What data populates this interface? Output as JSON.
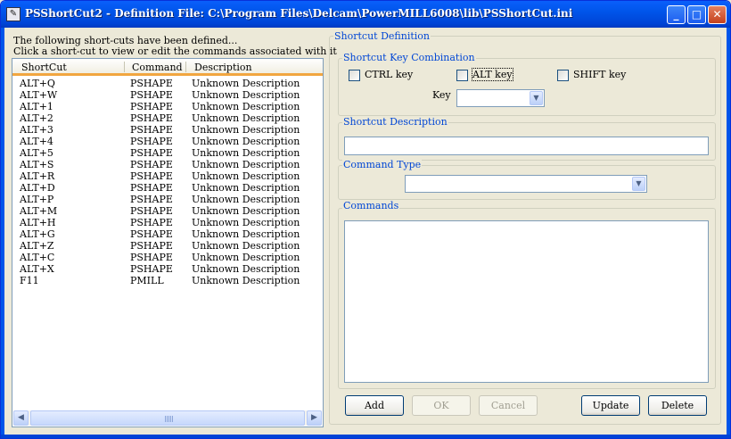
{
  "window": {
    "title": "PSShortCut2 - Definition File: C:\\Program Files\\Delcam\\PowerMILL6008\\lib\\PSShortCut.ini",
    "app_icon_glyph": "✎",
    "minimize_glyph": "_",
    "maximize_glyph": "□",
    "close_glyph": "✕"
  },
  "intro": {
    "line1": "The following short-cuts have been defined...",
    "line2": "Click a short-cut to view or edit the commands associated with it"
  },
  "list": {
    "columns": [
      "ShortCut",
      "Command",
      "Description"
    ],
    "rows": [
      [
        "ALT+Q",
        "PSHAPE",
        "Unknown Description"
      ],
      [
        "ALT+W",
        "PSHAPE",
        "Unknown Description"
      ],
      [
        "ALT+1",
        "PSHAPE",
        "Unknown Description"
      ],
      [
        "ALT+2",
        "PSHAPE",
        "Unknown Description"
      ],
      [
        "ALT+3",
        "PSHAPE",
        "Unknown Description"
      ],
      [
        "ALT+4",
        "PSHAPE",
        "Unknown Description"
      ],
      [
        "ALT+5",
        "PSHAPE",
        "Unknown Description"
      ],
      [
        "ALT+S",
        "PSHAPE",
        "Unknown Description"
      ],
      [
        "ALT+R",
        "PSHAPE",
        "Unknown Description"
      ],
      [
        "ALT+D",
        "PSHAPE",
        "Unknown Description"
      ],
      [
        "ALT+P",
        "PSHAPE",
        "Unknown Description"
      ],
      [
        "ALT+M",
        "PSHAPE",
        "Unknown Description"
      ],
      [
        "ALT+H",
        "PSHAPE",
        "Unknown Description"
      ],
      [
        "ALT+G",
        "PSHAPE",
        "Unknown Description"
      ],
      [
        "ALT+Z",
        "PSHAPE",
        "Unknown Description"
      ],
      [
        "ALT+C",
        "PSHAPE",
        "Unknown Description"
      ],
      [
        "ALT+X",
        "PSHAPE",
        "Unknown Description"
      ],
      [
        "F11",
        "PMILL",
        "Unknown Description"
      ]
    ],
    "scroll_left_glyph": "◀",
    "scroll_right_glyph": "▶"
  },
  "definition": {
    "title": "Shortcut Definition",
    "key_combination": {
      "label": "Shortcut Key Combination",
      "ctrl_label": "CTRL key",
      "alt_label": "ALT key",
      "shift_label": "SHIFT key",
      "key_label": "Key",
      "key_value": ""
    },
    "description": {
      "label": "Shortcut Description",
      "value": ""
    },
    "command_type": {
      "label": "Command Type",
      "value": ""
    },
    "commands": {
      "label": "Commands",
      "value": ""
    },
    "dropdown_glyph": "▼"
  },
  "buttons": {
    "add": "Add",
    "ok": "OK",
    "cancel": "Cancel",
    "update": "Update",
    "delete": "Delete"
  },
  "colors": {
    "titlebar": "#0055ea",
    "group_label": "#0046d5",
    "header_accent": "#f1a640",
    "window_bg": "#ece9d8"
  }
}
